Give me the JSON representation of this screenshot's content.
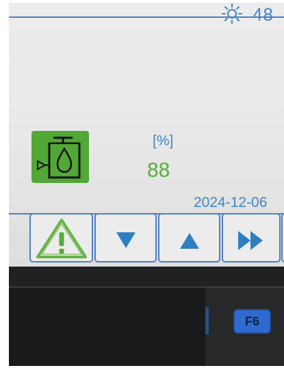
{
  "status_bar": {
    "brightness_icon": "sun-icon",
    "top_value": "48"
  },
  "tank_widget": {
    "icon": "oil-tank-level-icon",
    "unit": "[%]",
    "value": "88"
  },
  "date": "2024-12-06",
  "softkeys": [
    {
      "name": "warning",
      "icon": "warning-icon"
    },
    {
      "name": "down",
      "icon": "arrow-down-icon"
    },
    {
      "name": "up",
      "icon": "arrow-up-icon"
    },
    {
      "name": "fast-forward",
      "icon": "fast-forward-icon"
    }
  ],
  "keypad": {
    "f6_label": "F6"
  },
  "colors": {
    "accent_blue": "#3f86c6",
    "value_green": "#58ad38",
    "icon_green": "#52a836",
    "key_blue": "#2f6ad1"
  }
}
